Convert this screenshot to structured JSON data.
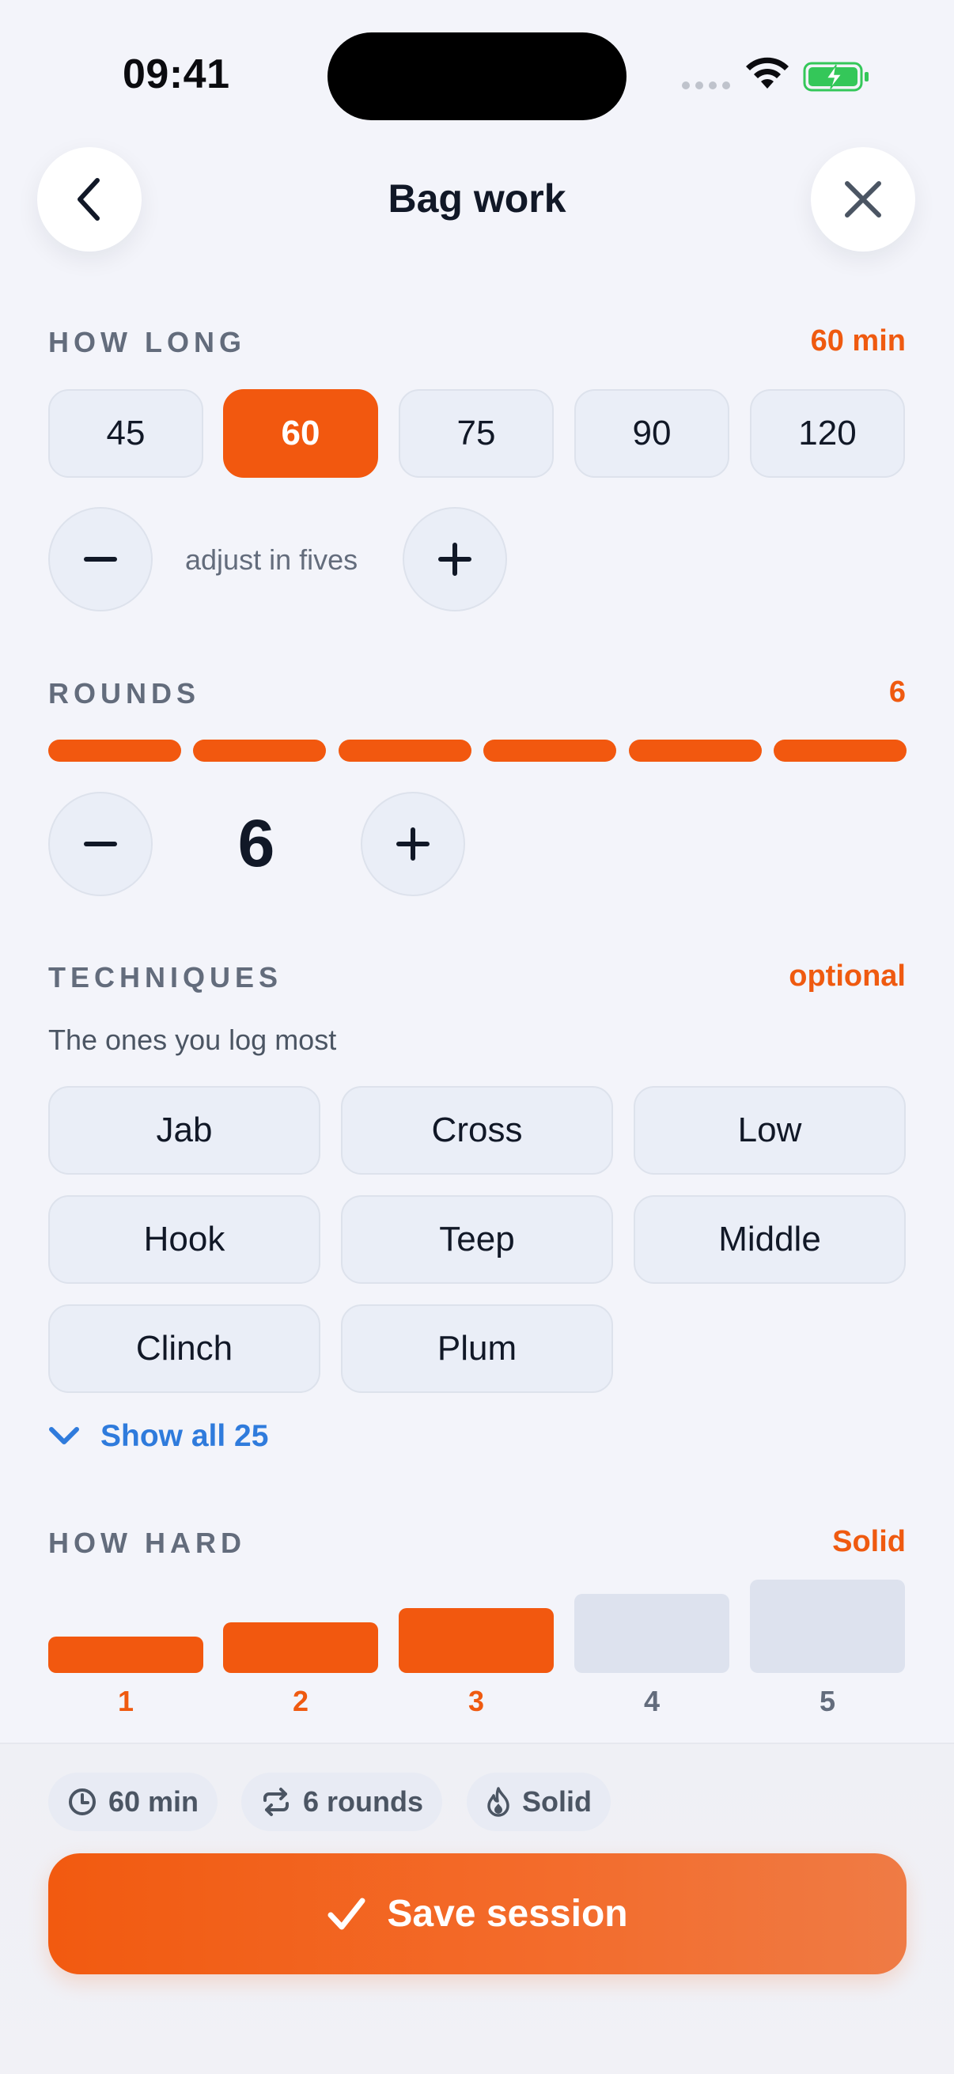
{
  "status_bar": {
    "time": "09:41"
  },
  "header": {
    "title": "Bag work",
    "back_icon": "chevron-left-icon",
    "close_icon": "close-icon"
  },
  "duration": {
    "label": "HOW LONG",
    "value": "60 min",
    "options": [
      "45",
      "60",
      "75",
      "90",
      "120"
    ],
    "selected": "60",
    "hint": "adjust in fives"
  },
  "rounds": {
    "label": "ROUNDS",
    "value": "6",
    "count": "6",
    "segments_filled": 6
  },
  "techniques": {
    "label": "TECHNIQUES",
    "value": "optional",
    "subtitle": "The ones you log most",
    "items": [
      "Jab",
      "Cross",
      "Low",
      "Hook",
      "Teep",
      "Middle",
      "Clinch",
      "Plum"
    ],
    "show_all": "Show all 25"
  },
  "intensity": {
    "label": "HOW HARD",
    "value": "Solid",
    "levels": [
      "1",
      "2",
      "3",
      "4",
      "5"
    ],
    "selected_level": 3
  },
  "summary": {
    "duration": "60 min",
    "rounds": "6 rounds",
    "intensity": "Solid"
  },
  "save": {
    "label": "Save session"
  },
  "colors": {
    "accent": "#f2580f",
    "link": "#2f7bdc",
    "chip_bg": "#eaeef7",
    "muted": "#636c7c"
  }
}
